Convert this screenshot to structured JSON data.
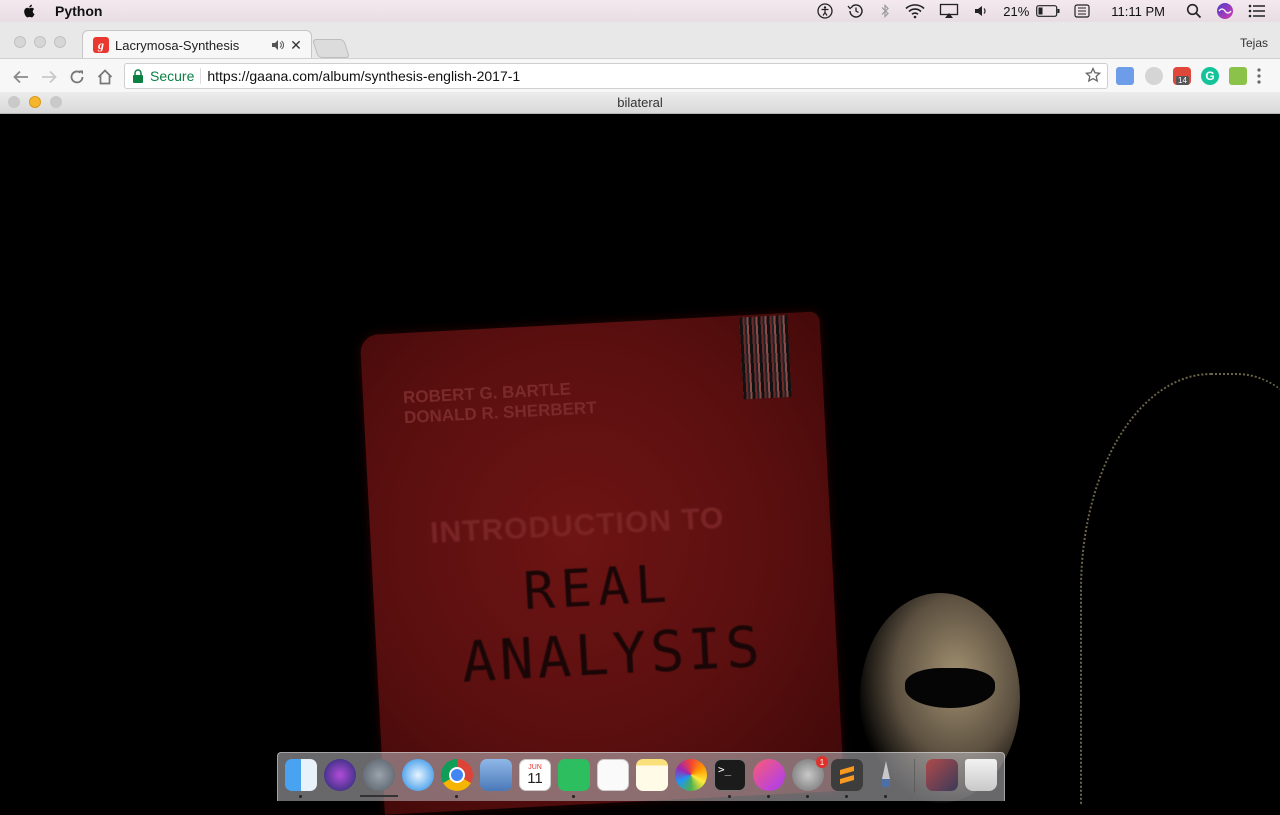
{
  "menubar": {
    "app_name": "Python",
    "battery_percent": "21%",
    "clock": "11:11 PM",
    "icons": [
      "apple-icon",
      "accessibility-icon",
      "time-machine-icon",
      "bluetooth-icon",
      "wifi-icon",
      "airplay-icon",
      "volume-icon",
      "battery-icon",
      "keyboard-icon",
      "spotlight-icon",
      "siri-icon",
      "notification-center-icon"
    ]
  },
  "browser": {
    "tab_title": "Lacrymosa-Synthesis",
    "tab_favicon_letter": "g",
    "profile_name": "Tejas",
    "security_label": "Secure",
    "url": "https://gaana.com/album/synthesis-english-2017-1",
    "extension_badge": "14"
  },
  "cv_window": {
    "title": "bilateral",
    "book": {
      "authors": [
        "ROBERT G. BARTLE",
        "DONALD R. SHERBERT"
      ],
      "line1": "INTRODUCTION TO",
      "line2": "REAL",
      "line3": "ANALYSIS"
    }
  },
  "dock": {
    "calendar_month": "JUN",
    "calendar_day": "11",
    "settings_badge": "1",
    "apps": [
      "finder",
      "siri",
      "launchpad",
      "safari",
      "chrome",
      "preview",
      "calendar",
      "evernote",
      "reminders",
      "notes",
      "photos",
      "terminal",
      "itunes",
      "system-preferences",
      "sublime-text",
      "pen-app",
      "downloads",
      "trash"
    ]
  }
}
